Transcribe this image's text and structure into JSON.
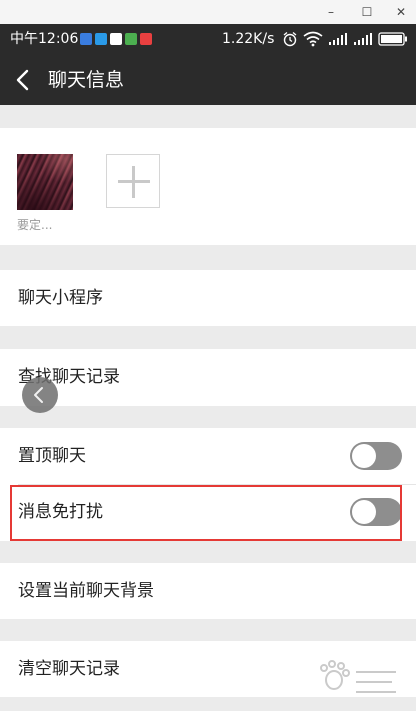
{
  "window": {
    "minimize": "–",
    "maximize": "☐",
    "close": "✕"
  },
  "status_bar": {
    "time": "中午12:06",
    "app_icon_colors": [
      "#3a7de0",
      "#2a9ae8",
      "#ffffff",
      "#4caf50",
      "#e94040"
    ],
    "net_speed": "1.22K/s",
    "icons": [
      "alarm-icon",
      "wifi-icon",
      "signal-icon",
      "signal-icon",
      "battery-icon"
    ]
  },
  "header": {
    "title": "聊天信息",
    "back_icon": "back-arrow-icon"
  },
  "members": [
    {
      "name": "要定..."
    }
  ],
  "add_member_icon": "plus-icon",
  "rows": {
    "mini_program": "聊天小程序",
    "find_history": "查找聊天记录",
    "pin_chat": {
      "label": "置顶聊天",
      "on": false
    },
    "mute": {
      "label": "消息免打扰",
      "on": false
    },
    "background": "设置当前聊天背景",
    "clear_history": "清空聊天记录"
  },
  "colors": {
    "bar": "#2b2b2b",
    "toggle_off": "#8e8e8e",
    "highlight": "#e53935"
  }
}
